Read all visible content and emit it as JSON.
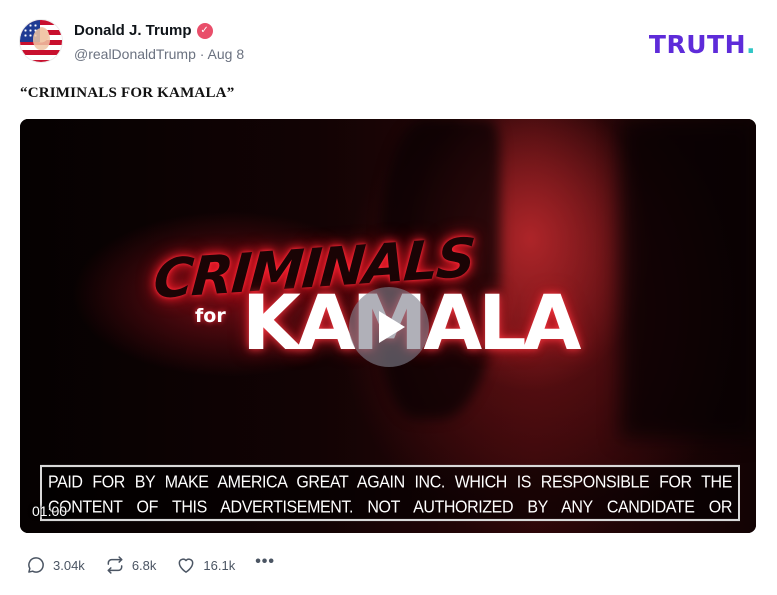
{
  "author": {
    "name": "Donald J. Trump",
    "verified_icon": "verified-badge-icon",
    "handle": "@realDonaldTrump",
    "separator": "·",
    "date": "Aug 8"
  },
  "brand": {
    "logo_text": "TRUTH",
    "logo_dot": ".",
    "logo_color": "#5e2bd9",
    "dot_color": "#30c6c6"
  },
  "post": {
    "text": "“CRIMINALS FOR KAMALA”"
  },
  "video": {
    "title_line1": "CRIMINALS",
    "title_for": "for",
    "title_line2": "KAMALA",
    "disclaimer": "PAID FOR BY MAKE AMERICA GREAT AGAIN INC. WHICH IS RESPONSIBLE FOR THE CONTENT OF THIS ADVERTISEMENT. NOT AUTHORIZED BY ANY CANDIDATE OR CANDIDATE'S COMMITTEE. MAGAPAC.COM",
    "duration": "01:00",
    "play_icon": "play-icon"
  },
  "actions": {
    "replies": "3.04k",
    "retruths": "6.8k",
    "likes": "16.1k",
    "reply_icon": "reply-icon",
    "retruth_icon": "retruth-icon",
    "like_icon": "heart-icon",
    "more_icon": "more-icon"
  }
}
